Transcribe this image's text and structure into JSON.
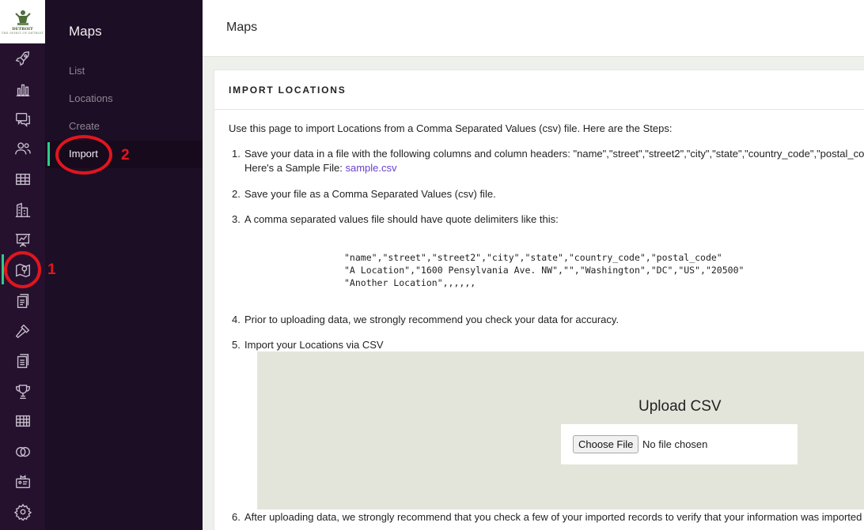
{
  "brand": {
    "line1": "DETROIT",
    "line2": "THE SPIRIT OF DETROIT"
  },
  "rail_icons": [
    "rocket-icon",
    "bar-chart-icon",
    "chat-icon",
    "users-icon",
    "table-icon",
    "buildings-icon",
    "presentation-icon",
    "map-icon",
    "documents-icon",
    "hammer-icon",
    "notes-icon",
    "trophy-icon",
    "grid-icon",
    "rings-icon",
    "badge-icon",
    "gear-icon"
  ],
  "subnav": {
    "title": "Maps",
    "items": [
      {
        "label": "List"
      },
      {
        "label": "Locations"
      },
      {
        "label": "Create"
      },
      {
        "label": "Import"
      }
    ]
  },
  "annotations": {
    "one": "1",
    "two": "2"
  },
  "header": {
    "title": "Maps"
  },
  "card": {
    "title": "IMPORT LOCATIONS",
    "intro": "Use this page to import Locations from a Comma Separated Values (csv) file. Here are the Steps:",
    "steps": [
      {
        "num": "1.",
        "text": "Save your data in a file with the following columns and column headers: \"name\",\"street\",\"street2\",\"city\",\"state\",\"country_code\",\"postal_code\"",
        "text2": "Here's a Sample File: ",
        "link": "sample.csv"
      },
      {
        "num": "2.",
        "text": "Save your file as a Comma Separated Values (csv) file."
      },
      {
        "num": "3.",
        "text": "A comma separated values file should have quote delimiters like this:"
      },
      {
        "num": "4.",
        "text": "Prior to uploading data, we strongly recommend you check your data for accuracy."
      },
      {
        "num": "5.",
        "text": "Import your Locations via CSV"
      },
      {
        "num": "6.",
        "text": "After uploading data, we strongly recommend that you check a few of your imported records to verify that your information was imported correctly."
      }
    ],
    "code": "\"name\",\"street\",\"street2\",\"city\",\"state\",\"country_code\",\"postal_code\"\n\"A Location\",\"1600 Pensylvania Ave. NW\",\"\",\"Washington\",\"DC\",\"US\",\"20500\"\n\"Another Location\",,,,,,",
    "upload": {
      "title": "Upload CSV",
      "button": "Choose File",
      "status": "No file chosen"
    }
  },
  "colors": {
    "rail_bg": "#25112e",
    "subnav_bg": "#1c0e24",
    "accent": "#2ecc8a",
    "annotation": "#e0161e",
    "link": "#6a3fd0"
  }
}
